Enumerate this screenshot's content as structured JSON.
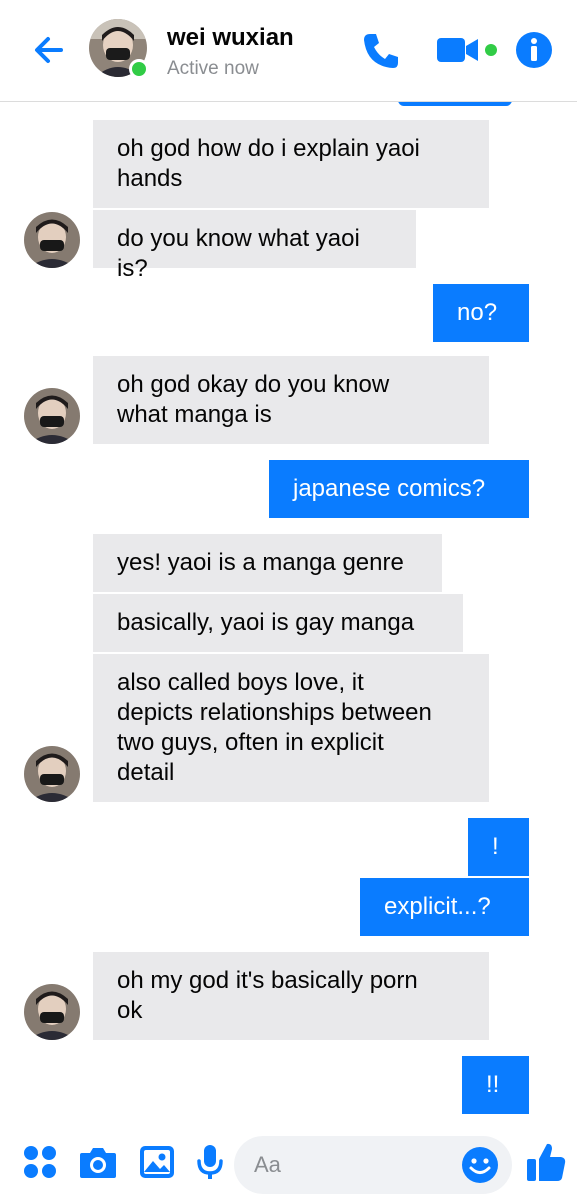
{
  "header": {
    "title": "wei wuxian",
    "status": "Active now"
  },
  "messages": [
    {
      "side": "in",
      "text": "oh god how do i explain yaoi\nhands"
    },
    {
      "side": "in",
      "text": "do you know what yaoi is?"
    },
    {
      "side": "out",
      "text": "no?"
    },
    {
      "side": "in",
      "text": "oh god okay do you know\nwhat manga is"
    },
    {
      "side": "out",
      "text": "japanese comics?"
    },
    {
      "side": "in",
      "text": "yes! yaoi is a manga genre"
    },
    {
      "side": "in",
      "text": "basically, yaoi is gay manga"
    },
    {
      "side": "in",
      "text": "also called boys love, it\ndepicts relationships between\ntwo guys, often in explicit\ndetail"
    },
    {
      "side": "out",
      "text": "!"
    },
    {
      "side": "out",
      "text": "explicit...?"
    },
    {
      "side": "in",
      "text": "oh my god it's basically porn\nok"
    },
    {
      "side": "out",
      "text": "!!"
    }
  ],
  "composer": {
    "placeholder": "Aa"
  },
  "icons": {
    "back": "arrow-left-icon",
    "call": "phone-icon",
    "video": "video-camera-icon",
    "info": "info-icon",
    "more": "four-dots-icon",
    "camera": "camera-icon",
    "gallery": "image-icon",
    "mic": "microphone-icon",
    "emoji": "emoji-icon",
    "like": "thumbs-up-icon"
  },
  "colors": {
    "accent": "#0a7cff",
    "incoming_bubble": "#e9e9eb",
    "online": "#31cc46"
  }
}
